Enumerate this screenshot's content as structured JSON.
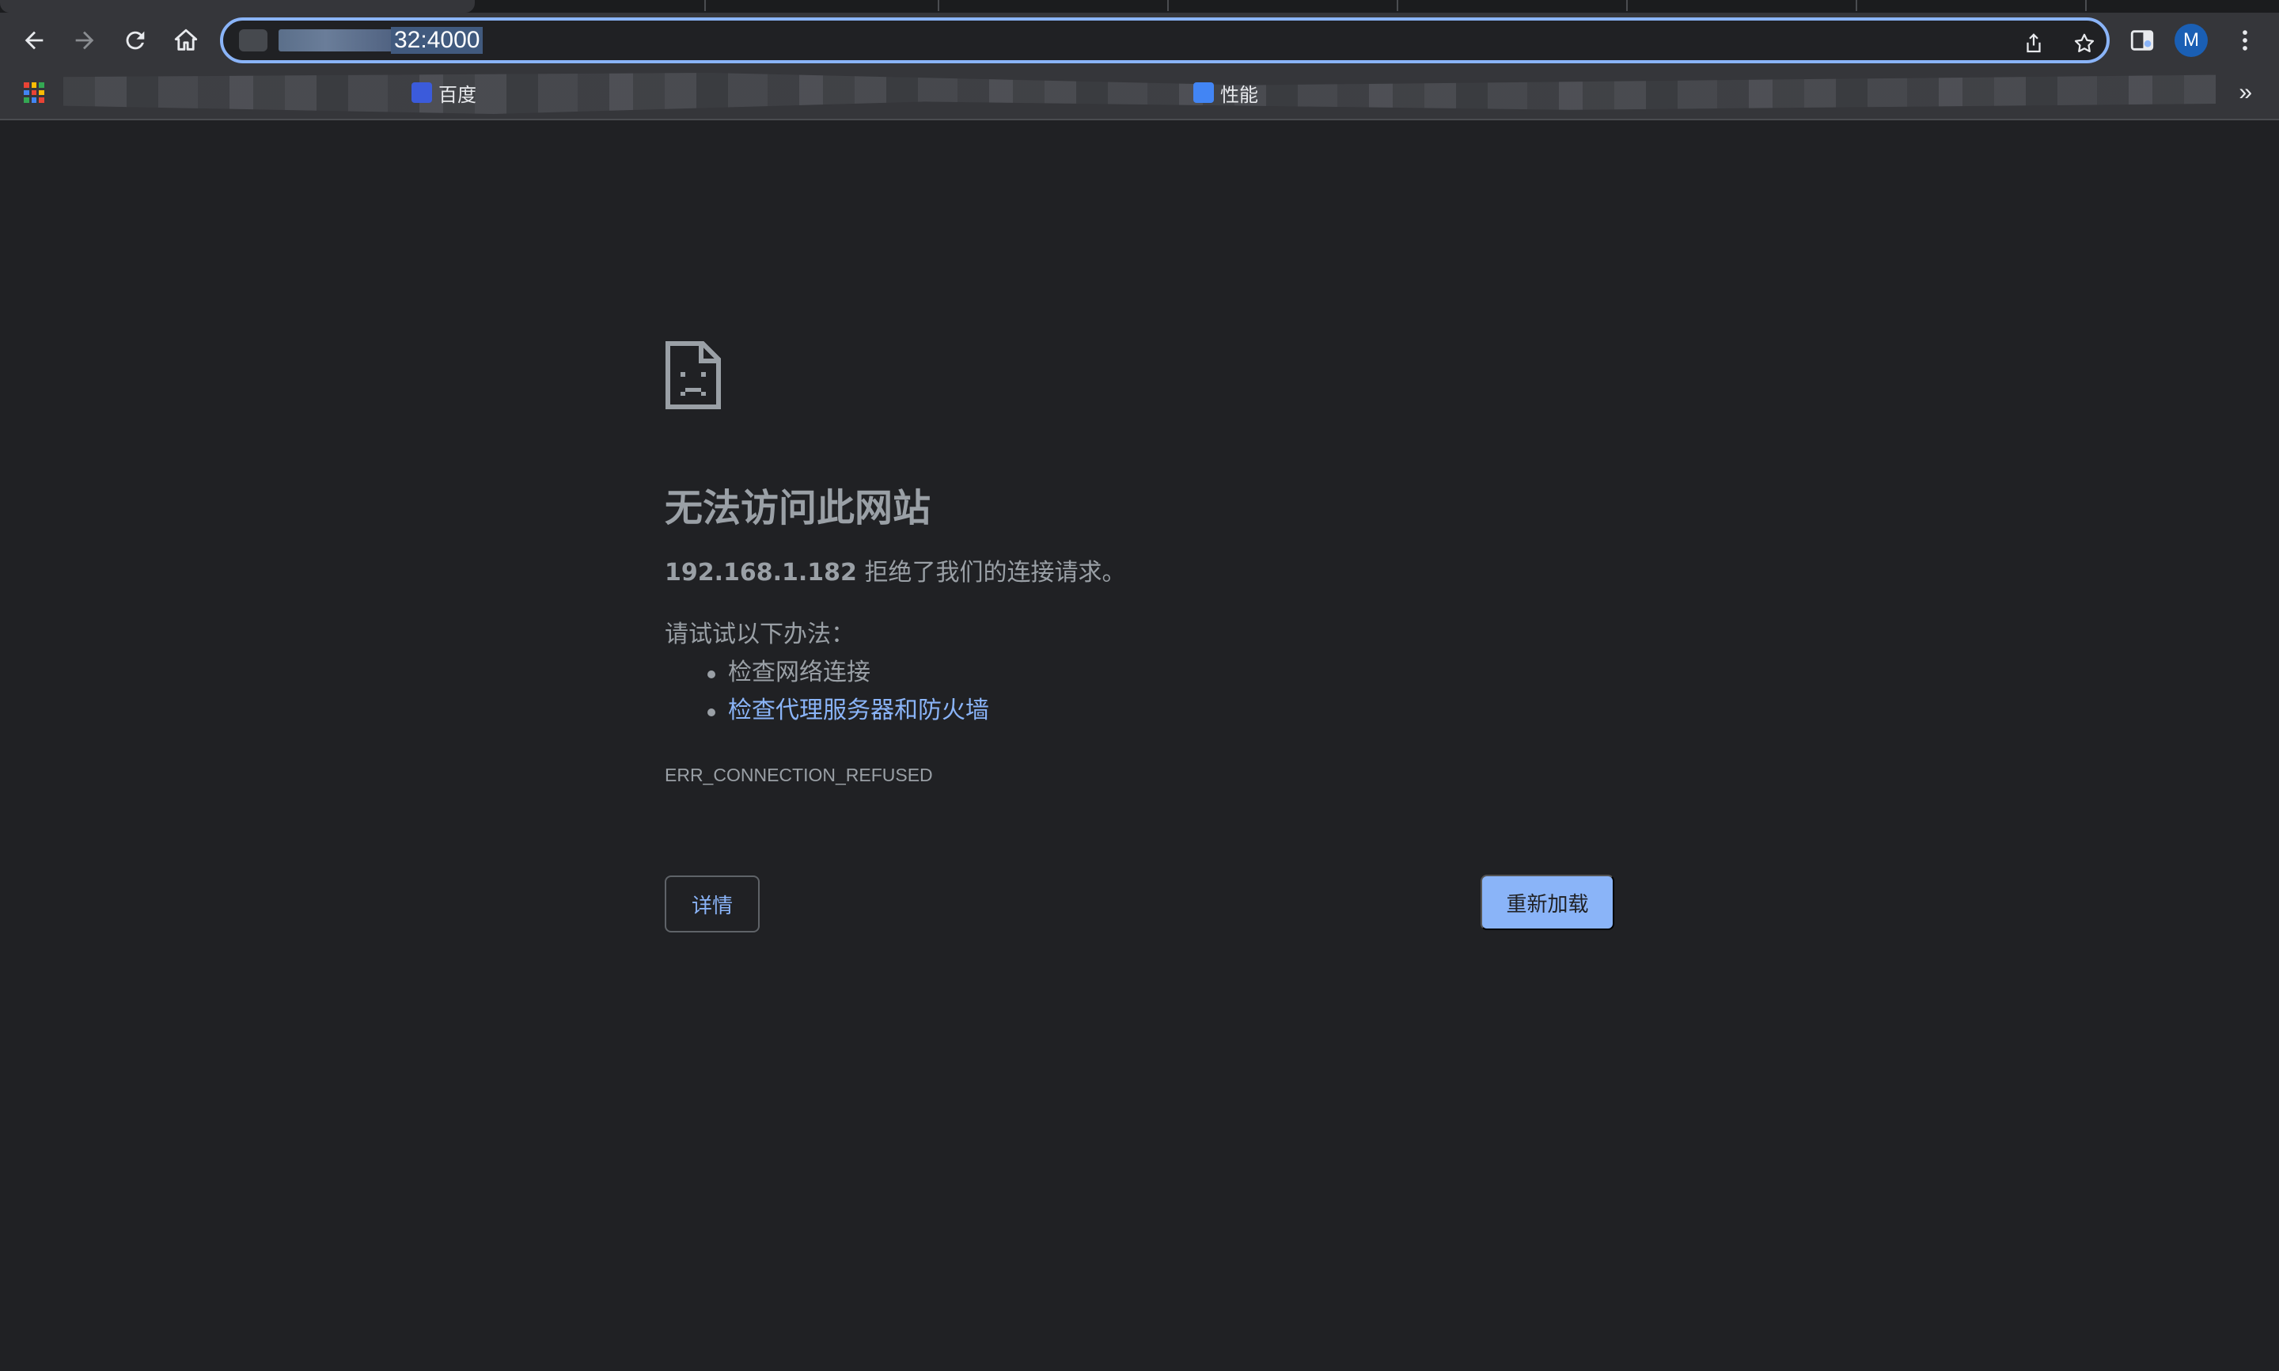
{
  "browser": {
    "url_text": "32:4000",
    "profile_initial": "M",
    "bookmarks": [
      {
        "label": "百度",
        "color": "#3b5bdb"
      },
      {
        "label": "性能",
        "color": "#4285f4"
      }
    ],
    "bookmarks_overflow": "»",
    "icons": {
      "back": "arrow-left-icon",
      "forward": "arrow-right-icon",
      "reload": "reload-icon",
      "home": "home-icon",
      "share": "share-icon",
      "bookmark": "star-icon",
      "extensions": "side-panel-icon",
      "menu": "more-vert-icon"
    }
  },
  "error_page": {
    "icon": "sad-document-icon",
    "title": "无法访问此网站",
    "host": "192.168.1.182",
    "summary_suffix": " 拒绝了我们的连接请求。",
    "suggestions_heading": "请试试以下办法：",
    "suggestions": [
      {
        "text": "检查网络连接",
        "is_link": false
      },
      {
        "text": "检查代理服务器和防火墙",
        "is_link": true
      }
    ],
    "error_code": "ERR_CONNECTION_REFUSED",
    "details_button": "详情",
    "reload_button": "重新加载"
  },
  "colors": {
    "background": "#202124",
    "toolbar": "#35363a",
    "link": "#8ab4f8",
    "text": "#9aa0a6",
    "accent_button": "#8ab4f8"
  }
}
